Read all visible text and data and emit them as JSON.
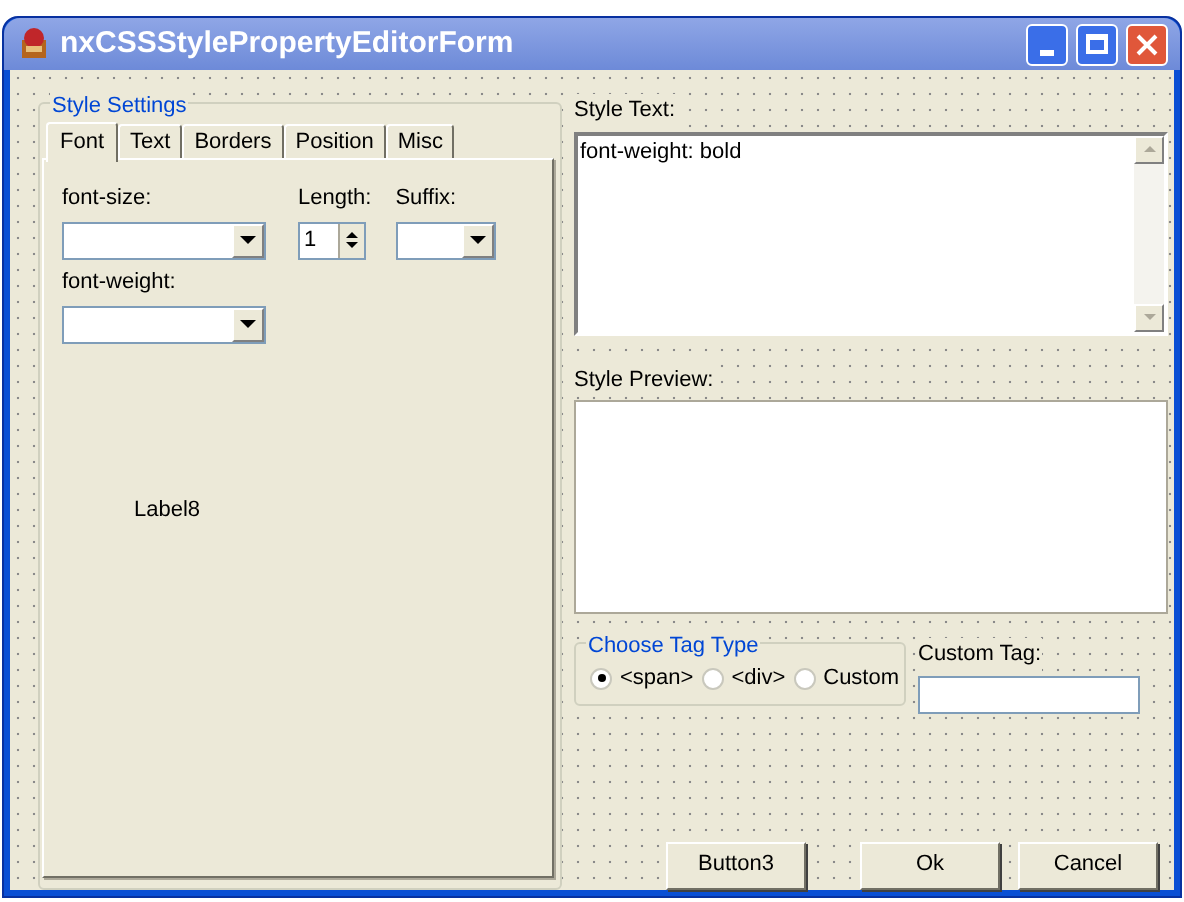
{
  "window": {
    "title": "nxCSSStylePropertyEditorForm"
  },
  "style_settings": {
    "title": "Style Settings",
    "tabs": [
      {
        "label": "Font",
        "selected": true
      },
      {
        "label": "Text",
        "selected": false
      },
      {
        "label": "Borders",
        "selected": false
      },
      {
        "label": "Position",
        "selected": false
      },
      {
        "label": "Misc",
        "selected": false
      }
    ],
    "font_size_label": "font-size:",
    "length_label": "Length:",
    "length_value": "1",
    "suffix_label": "Suffix:",
    "font_weight_label": "font-weight:",
    "label8": "Label8"
  },
  "style_text": {
    "label": "Style Text:",
    "value": "font-weight: bold"
  },
  "style_preview": {
    "label": "Style Preview:"
  },
  "tag_type": {
    "title": "Choose Tag Type",
    "options": [
      {
        "label": "<span>",
        "selected": true
      },
      {
        "label": "<div>",
        "selected": false
      },
      {
        "label": "Custom",
        "selected": false
      }
    ]
  },
  "custom_tag": {
    "label": "Custom Tag:"
  },
  "buttons": [
    "Button3",
    "Ok",
    "Cancel"
  ]
}
